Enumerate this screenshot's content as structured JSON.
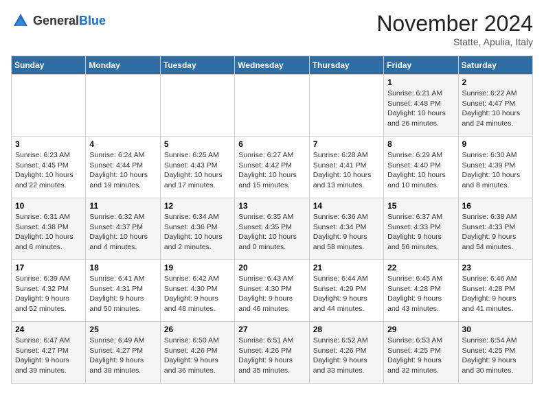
{
  "logo": {
    "text_general": "General",
    "text_blue": "Blue"
  },
  "header": {
    "title": "November 2024",
    "subtitle": "Statte, Apulia, Italy"
  },
  "weekdays": [
    "Sunday",
    "Monday",
    "Tuesday",
    "Wednesday",
    "Thursday",
    "Friday",
    "Saturday"
  ],
  "weeks": [
    [
      {
        "day": "",
        "info": ""
      },
      {
        "day": "",
        "info": ""
      },
      {
        "day": "",
        "info": ""
      },
      {
        "day": "",
        "info": ""
      },
      {
        "day": "",
        "info": ""
      },
      {
        "day": "1",
        "info": "Sunrise: 6:21 AM\nSunset: 4:48 PM\nDaylight: 10 hours and 26 minutes."
      },
      {
        "day": "2",
        "info": "Sunrise: 6:22 AM\nSunset: 4:47 PM\nDaylight: 10 hours and 24 minutes."
      }
    ],
    [
      {
        "day": "3",
        "info": "Sunrise: 6:23 AM\nSunset: 4:45 PM\nDaylight: 10 hours and 22 minutes."
      },
      {
        "day": "4",
        "info": "Sunrise: 6:24 AM\nSunset: 4:44 PM\nDaylight: 10 hours and 19 minutes."
      },
      {
        "day": "5",
        "info": "Sunrise: 6:25 AM\nSunset: 4:43 PM\nDaylight: 10 hours and 17 minutes."
      },
      {
        "day": "6",
        "info": "Sunrise: 6:27 AM\nSunset: 4:42 PM\nDaylight: 10 hours and 15 minutes."
      },
      {
        "day": "7",
        "info": "Sunrise: 6:28 AM\nSunset: 4:41 PM\nDaylight: 10 hours and 13 minutes."
      },
      {
        "day": "8",
        "info": "Sunrise: 6:29 AM\nSunset: 4:40 PM\nDaylight: 10 hours and 10 minutes."
      },
      {
        "day": "9",
        "info": "Sunrise: 6:30 AM\nSunset: 4:39 PM\nDaylight: 10 hours and 8 minutes."
      }
    ],
    [
      {
        "day": "10",
        "info": "Sunrise: 6:31 AM\nSunset: 4:38 PM\nDaylight: 10 hours and 6 minutes."
      },
      {
        "day": "11",
        "info": "Sunrise: 6:32 AM\nSunset: 4:37 PM\nDaylight: 10 hours and 4 minutes."
      },
      {
        "day": "12",
        "info": "Sunrise: 6:34 AM\nSunset: 4:36 PM\nDaylight: 10 hours and 2 minutes."
      },
      {
        "day": "13",
        "info": "Sunrise: 6:35 AM\nSunset: 4:35 PM\nDaylight: 10 hours and 0 minutes."
      },
      {
        "day": "14",
        "info": "Sunrise: 6:36 AM\nSunset: 4:34 PM\nDaylight: 9 hours and 58 minutes."
      },
      {
        "day": "15",
        "info": "Sunrise: 6:37 AM\nSunset: 4:33 PM\nDaylight: 9 hours and 56 minutes."
      },
      {
        "day": "16",
        "info": "Sunrise: 6:38 AM\nSunset: 4:33 PM\nDaylight: 9 hours and 54 minutes."
      }
    ],
    [
      {
        "day": "17",
        "info": "Sunrise: 6:39 AM\nSunset: 4:32 PM\nDaylight: 9 hours and 52 minutes."
      },
      {
        "day": "18",
        "info": "Sunrise: 6:41 AM\nSunset: 4:31 PM\nDaylight: 9 hours and 50 minutes."
      },
      {
        "day": "19",
        "info": "Sunrise: 6:42 AM\nSunset: 4:30 PM\nDaylight: 9 hours and 48 minutes."
      },
      {
        "day": "20",
        "info": "Sunrise: 6:43 AM\nSunset: 4:30 PM\nDaylight: 9 hours and 46 minutes."
      },
      {
        "day": "21",
        "info": "Sunrise: 6:44 AM\nSunset: 4:29 PM\nDaylight: 9 hours and 44 minutes."
      },
      {
        "day": "22",
        "info": "Sunrise: 6:45 AM\nSunset: 4:28 PM\nDaylight: 9 hours and 43 minutes."
      },
      {
        "day": "23",
        "info": "Sunrise: 6:46 AM\nSunset: 4:28 PM\nDaylight: 9 hours and 41 minutes."
      }
    ],
    [
      {
        "day": "24",
        "info": "Sunrise: 6:47 AM\nSunset: 4:27 PM\nDaylight: 9 hours and 39 minutes."
      },
      {
        "day": "25",
        "info": "Sunrise: 6:49 AM\nSunset: 4:27 PM\nDaylight: 9 hours and 38 minutes."
      },
      {
        "day": "26",
        "info": "Sunrise: 6:50 AM\nSunset: 4:26 PM\nDaylight: 9 hours and 36 minutes."
      },
      {
        "day": "27",
        "info": "Sunrise: 6:51 AM\nSunset: 4:26 PM\nDaylight: 9 hours and 35 minutes."
      },
      {
        "day": "28",
        "info": "Sunrise: 6:52 AM\nSunset: 4:26 PM\nDaylight: 9 hours and 33 minutes."
      },
      {
        "day": "29",
        "info": "Sunrise: 6:53 AM\nSunset: 4:25 PM\nDaylight: 9 hours and 32 minutes."
      },
      {
        "day": "30",
        "info": "Sunrise: 6:54 AM\nSunset: 4:25 PM\nDaylight: 9 hours and 30 minutes."
      }
    ]
  ]
}
